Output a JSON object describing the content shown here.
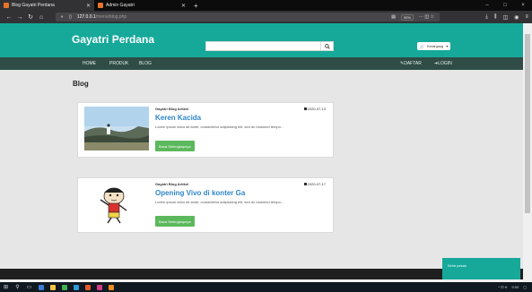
{
  "browser": {
    "tabs": [
      {
        "label": "Blog Gayatri Perdana",
        "active": true
      },
      {
        "label": "Admin Gayatri",
        "active": false
      }
    ],
    "new_tab": "+",
    "url_host": "127.0.0.1",
    "url_path": "/menu/blog.php",
    "zoom": "90%",
    "window_controls": [
      "–",
      "□",
      "×"
    ],
    "icons": [
      "back-icon",
      "forward-icon",
      "reload-icon",
      "home-icon",
      "shield-icon",
      "page-icon",
      "reader-icon",
      "more-icon",
      "pocket-icon",
      "bookmark-star-icon",
      "download-icon",
      "library-icon",
      "sidebar-icon",
      "account-icon",
      "menu-icon"
    ]
  },
  "header": {
    "brand": "Gayatri Perdana",
    "search_placeholder": "",
    "cart_label": "Keranjang"
  },
  "nav": {
    "left": [
      "HOME",
      "PRODUK",
      "BLOG"
    ],
    "daftar": "DAFTAR",
    "login": "LOGIN"
  },
  "main": {
    "heading": "Blog",
    "posts": [
      {
        "category": "Gayatri Blog Artikel",
        "date": "2020-07-13",
        "title": "Keren Kacida",
        "excerpt": "Lorem ipsum dolor sit amet, consectetur adipisicing elit, sed do eiusmod tempo...",
        "button": "Baca Selengkapnya"
      },
      {
        "category": "Gayatri Blog Artikel",
        "date": "2020-07-17",
        "title": "Opening Vivo di konter Ga",
        "excerpt": "Lorem ipsum dolor sit amet, consectetur adipisicing elit, sed do eiusmod tempo...",
        "button": "Baca Selengkapnya"
      }
    ]
  },
  "chat": {
    "label": "Kirim pesan"
  },
  "taskbar": {
    "clock": "9:00",
    "colors": {
      "accent": "#16a99a",
      "menu": "#2f4c46",
      "button": "#5cb85c",
      "title": "#2f86c9"
    }
  }
}
